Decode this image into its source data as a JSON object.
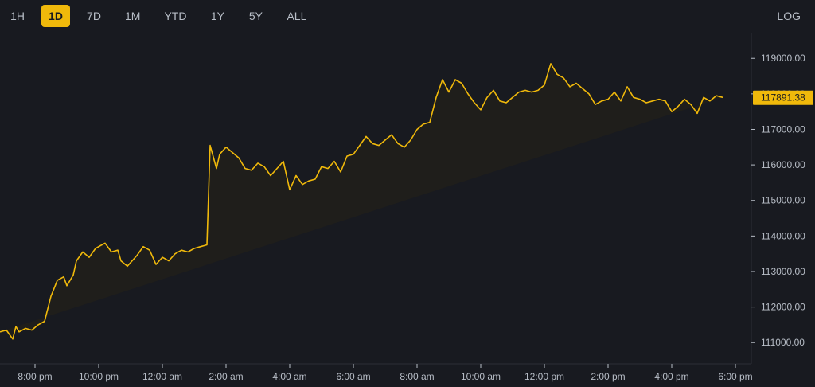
{
  "toolbar": {
    "timeframes": [
      {
        "label": "1H",
        "active": false
      },
      {
        "label": "1D",
        "active": true
      },
      {
        "label": "7D",
        "active": false
      },
      {
        "label": "1M",
        "active": false
      },
      {
        "label": "YTD",
        "active": false
      },
      {
        "label": "1Y",
        "active": false
      },
      {
        "label": "5Y",
        "active": false
      },
      {
        "label": "ALL",
        "active": false
      }
    ],
    "log_label": "LOG"
  },
  "colors": {
    "background": "#181a20",
    "line": "#f0b90b",
    "fill": "#1f1e1b",
    "text": "#b7bdc6",
    "grid": "#2b2f36"
  },
  "chart_data": {
    "type": "area",
    "title": "",
    "xlabel": "",
    "ylabel": "",
    "current_price": 117891.38,
    "current_price_label": "117891.38",
    "ylim": [
      110400,
      119700
    ],
    "y_ticks": [
      111000,
      112000,
      113000,
      114000,
      115000,
      116000,
      117000,
      118000,
      119000
    ],
    "y_tick_labels": [
      "111000.00",
      "112000.00",
      "113000.00",
      "114000.00",
      "115000.00",
      "116000.00",
      "117000.00",
      "118000.00",
      "119000.00"
    ],
    "x_unit": "hours",
    "xlim": [
      18.9,
      42.5
    ],
    "x_ticks": [
      20,
      22,
      24,
      26,
      28,
      30,
      32,
      34,
      36,
      38,
      40,
      42
    ],
    "x_tick_labels": [
      "8:00 pm",
      "10:00 pm",
      "12:00 am",
      "2:00 am",
      "4:00 am",
      "6:00 am",
      "8:00 am",
      "10:00 am",
      "12:00 pm",
      "2:00 pm",
      "4:00 pm",
      "6:00 pm"
    ],
    "grid": false,
    "x": [
      18.9,
      19.1,
      19.3,
      19.4,
      19.5,
      19.7,
      19.9,
      20.1,
      20.3,
      20.5,
      20.7,
      20.9,
      21.0,
      21.2,
      21.3,
      21.5,
      21.7,
      21.9,
      22.1,
      22.2,
      22.4,
      22.6,
      22.7,
      22.9,
      23.2,
      23.4,
      23.6,
      23.8,
      24.0,
      24.2,
      24.4,
      24.6,
      24.8,
      25.0,
      25.2,
      25.4,
      25.5,
      25.7,
      25.8,
      26.0,
      26.2,
      26.4,
      26.6,
      26.8,
      27.0,
      27.2,
      27.4,
      27.6,
      27.8,
      28.0,
      28.2,
      28.4,
      28.6,
      28.8,
      29.0,
      29.2,
      29.4,
      29.6,
      29.8,
      30.0,
      30.2,
      30.4,
      30.6,
      30.8,
      31.0,
      31.2,
      31.4,
      31.6,
      31.8,
      32.0,
      32.2,
      32.4,
      32.6,
      32.8,
      33.0,
      33.2,
      33.4,
      33.6,
      33.8,
      34.0,
      34.2,
      34.4,
      34.6,
      34.8,
      35.0,
      35.2,
      35.4,
      35.6,
      35.8,
      36.0,
      36.2,
      36.4,
      36.6,
      36.8,
      37.0,
      37.2,
      37.4,
      37.6,
      37.8,
      38.0,
      38.2,
      38.4,
      38.6,
      38.8,
      39.0,
      39.2,
      39.4,
      39.6,
      39.8,
      40.0,
      40.2,
      40.4,
      40.6,
      40.8,
      41.0,
      41.2,
      41.4,
      41.6,
      41.8,
      42.0,
      42.2,
      42.4
    ],
    "y": [
      111300,
      111350,
      111100,
      111450,
      111300,
      111400,
      111350,
      111500,
      111600,
      112300,
      112750,
      112850,
      112600,
      112900,
      113300,
      113550,
      113400,
      113650,
      113750,
      113800,
      113550,
      113600,
      113300,
      113150,
      113450,
      113700,
      113600,
      113200,
      113400,
      113300,
      113500,
      113600,
      113550,
      113650,
      113700,
      113750,
      116550,
      115900,
      116300,
      116500,
      116350,
      116200,
      115900,
      115850,
      116050,
      115950,
      115700,
      115900,
      116100,
      115300,
      115700,
      115450,
      115550,
      115600,
      115950,
      115900,
      116100,
      115800,
      116250,
      116300,
      116550,
      116800,
      116600,
      116550,
      116700,
      116850,
      116600,
      116500,
      116700,
      117000,
      117150,
      117200,
      117900,
      118400,
      118050,
      118400,
      118300,
      118000,
      117750,
      117550,
      117900,
      118100,
      117800,
      117750,
      117900,
      118050,
      118100,
      118050,
      118100,
      118250,
      118850,
      118550,
      118450,
      118200,
      118300,
      118150,
      118000,
      117700,
      117800,
      117850,
      118050,
      117800,
      118200,
      117900,
      117850,
      117750,
      117800,
      117850,
      117800,
      117500,
      117650,
      117850,
      117700,
      117450,
      117900,
      117800,
      117950,
      117900
    ]
  }
}
